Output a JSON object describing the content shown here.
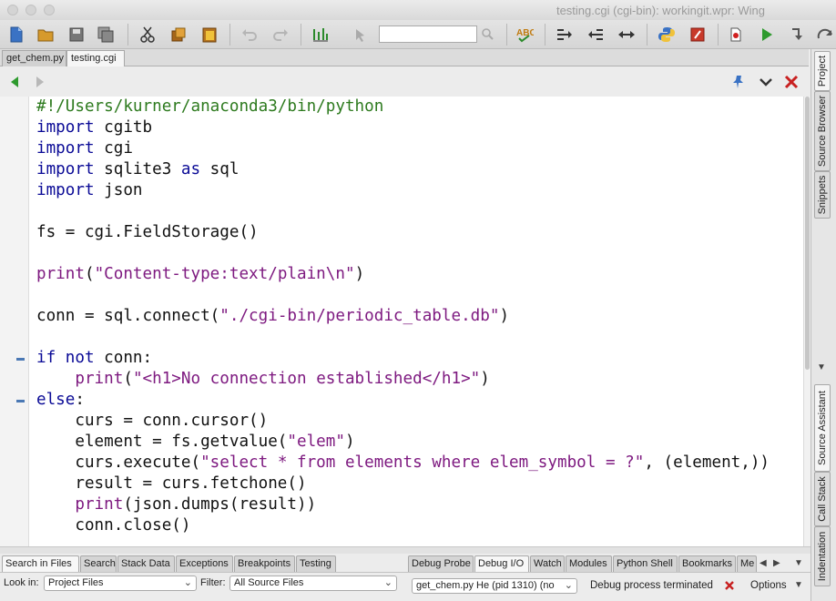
{
  "window": {
    "title": "testing.cgi (cgi-bin): workingit.wpr: Wing"
  },
  "toolbar": {
    "search_value": "",
    "icons": [
      "new-file-icon",
      "open-folder-icon",
      "save-icon",
      "save-all-icon",
      "cut-icon",
      "copy-icon",
      "paste-icon",
      "undo-icon",
      "redo-icon",
      "indent-guide-icon",
      "select-icon",
      "search-icon",
      "spell-check-icon",
      "indent-icon",
      "outdent-icon",
      "reformat-icon",
      "python-icon",
      "debug-settings-icon",
      "breakpoint-icon",
      "run-icon",
      "step-into-icon",
      "step-over-icon"
    ]
  },
  "editor_tabs": [
    {
      "label": "get_chem.py",
      "active": false
    },
    {
      "label": "testing.cgi",
      "active": true
    }
  ],
  "editor": {
    "lines": [
      [
        {
          "t": "#!/Users/kurner/anaconda3/bin/python",
          "c": "cmt"
        }
      ],
      [
        {
          "t": "import",
          "c": "kw"
        },
        {
          "t": " cgitb",
          "c": ""
        }
      ],
      [
        {
          "t": "import",
          "c": "kw"
        },
        {
          "t": " cgi",
          "c": ""
        }
      ],
      [
        {
          "t": "import",
          "c": "kw"
        },
        {
          "t": " sqlite3 ",
          "c": ""
        },
        {
          "t": "as",
          "c": "kw"
        },
        {
          "t": " sql",
          "c": ""
        }
      ],
      [
        {
          "t": "import",
          "c": "kw"
        },
        {
          "t": " json",
          "c": ""
        }
      ],
      [],
      [
        {
          "t": "fs = cgi.FieldStorage()",
          "c": ""
        }
      ],
      [],
      [
        {
          "t": "print",
          "c": "str"
        },
        {
          "t": "(",
          "c": ""
        },
        {
          "t": "\"Content-type:text/plain\\n\"",
          "c": "str"
        },
        {
          "t": ")",
          "c": ""
        }
      ],
      [],
      [
        {
          "t": "conn = sql.connect(",
          "c": ""
        },
        {
          "t": "\"./cgi-bin/periodic_table.db\"",
          "c": "str"
        },
        {
          "t": ")",
          "c": ""
        }
      ],
      [],
      [
        {
          "t": "if",
          "c": "kw"
        },
        {
          "t": " ",
          "c": ""
        },
        {
          "t": "not",
          "c": "kw"
        },
        {
          "t": " conn:",
          "c": ""
        }
      ],
      [
        {
          "t": "    ",
          "c": ""
        },
        {
          "t": "print",
          "c": "str"
        },
        {
          "t": "(",
          "c": ""
        },
        {
          "t": "\"<h1>No connection established</h1>\"",
          "c": "str"
        },
        {
          "t": ")",
          "c": ""
        }
      ],
      [
        {
          "t": "else",
          "c": "kw"
        },
        {
          "t": ":",
          "c": ""
        }
      ],
      [
        {
          "t": "    curs = conn.cursor()",
          "c": ""
        }
      ],
      [
        {
          "t": "    element = fs.getvalue(",
          "c": ""
        },
        {
          "t": "\"elem\"",
          "c": "str"
        },
        {
          "t": ")",
          "c": ""
        }
      ],
      [
        {
          "t": "    curs.execute(",
          "c": ""
        },
        {
          "t": "\"select * from elements where elem_symbol = ?\"",
          "c": "str"
        },
        {
          "t": ", (element,))",
          "c": ""
        }
      ],
      [
        {
          "t": "    result = curs.fetchone()",
          "c": ""
        }
      ],
      [
        {
          "t": "    ",
          "c": ""
        },
        {
          "t": "print",
          "c": "str"
        },
        {
          "t": "(json.dumps(result))",
          "c": ""
        }
      ],
      [
        {
          "t": "    conn.close()",
          "c": ""
        }
      ]
    ]
  },
  "side_tabs": [
    {
      "label": "Project",
      "active": true
    },
    {
      "label": "Source Browser",
      "active": false
    },
    {
      "label": "Snippets",
      "active": false
    },
    {
      "label": "Source Assistant",
      "active": true
    },
    {
      "label": "Call Stack",
      "active": false
    },
    {
      "label": "Indentation",
      "active": false
    }
  ],
  "bottom_left_tabs": [
    {
      "label": "Search in Files",
      "active": true
    },
    {
      "label": "Search",
      "active": false
    },
    {
      "label": "Stack Data",
      "active": false
    },
    {
      "label": "Exceptions",
      "active": false
    },
    {
      "label": "Breakpoints",
      "active": false
    },
    {
      "label": "Testing",
      "active": false
    }
  ],
  "bottom_right_tabs": [
    {
      "label": "Debug Probe",
      "active": false
    },
    {
      "label": "Debug I/O",
      "active": true
    },
    {
      "label": "Watch",
      "active": false
    },
    {
      "label": "Modules",
      "active": false
    },
    {
      "label": "Python Shell",
      "active": false
    },
    {
      "label": "Bookmarks",
      "active": false
    },
    {
      "label": "Me",
      "active": false
    }
  ],
  "search_panel": {
    "look_in_label": "Look in:",
    "look_in_value": "Project Files",
    "filter_label": "Filter:",
    "filter_value": "All Source Files"
  },
  "debug_panel": {
    "process_value": "get_chem.py He (pid 1310) (no",
    "status": "Debug process terminated",
    "options_label": "Options"
  },
  "colors": {
    "keyword": "#0a0a96",
    "string": "#7e1a80",
    "comment": "#2d7a1e",
    "run_green": "#2e9a2e",
    "close_red": "#c82020"
  }
}
